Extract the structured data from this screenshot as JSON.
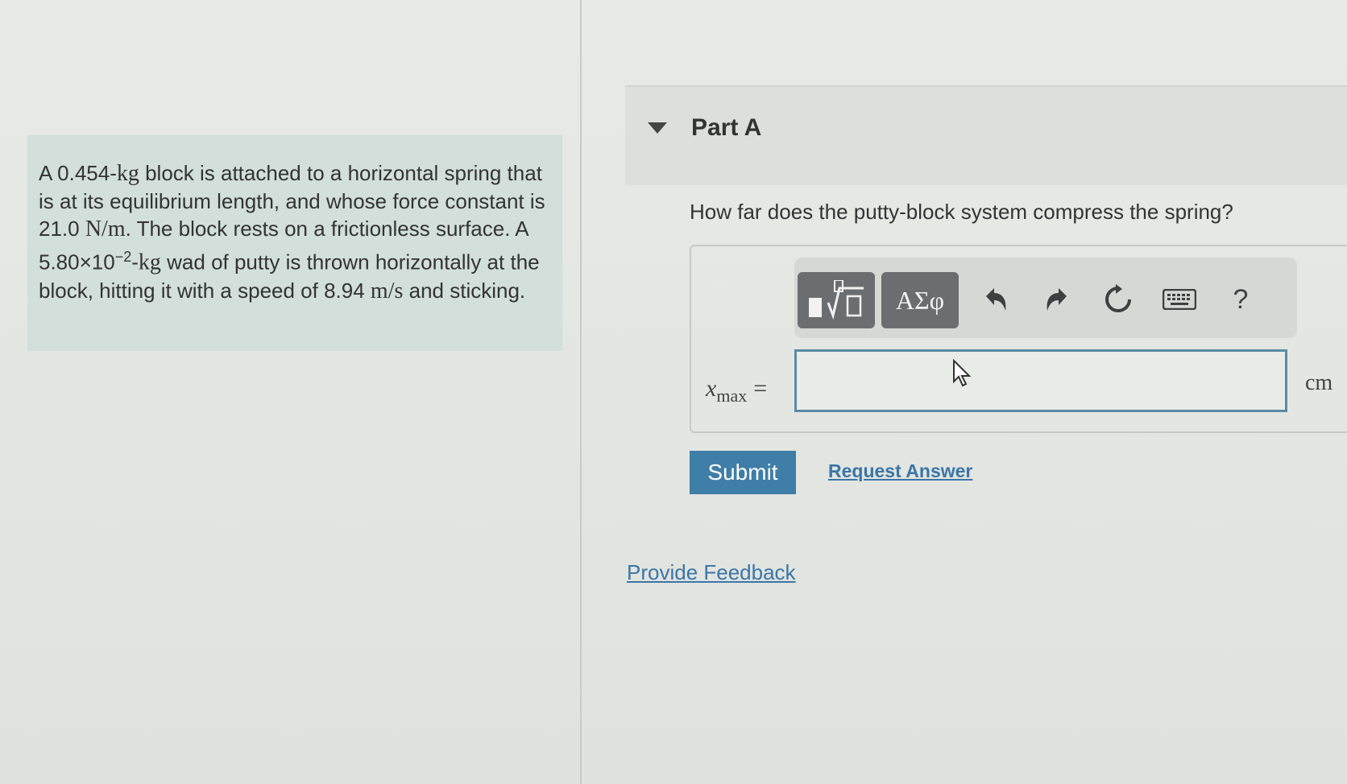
{
  "problem": {
    "seg1": "A 0.454-",
    "unit_kg1": "kg",
    "seg2": " block is attached to a horizontal spring that is at its equilibrium length, and whose force constant is 21.0 ",
    "unit_nm": "N/m",
    "seg3": ". The block rests on a frictionless surface. A 5.80×10",
    "exp": "−2",
    "seg4": "-",
    "unit_kg2": "kg",
    "seg5": " wad of putty is thrown horizontally at the block, hitting it with a speed of 8.94 ",
    "unit_ms": "m/s",
    "seg6": " and sticking."
  },
  "part": {
    "title": "Part A"
  },
  "question": "How far does the putty-block system compress the spring?",
  "toolbar": {
    "greek_label": "ΑΣφ",
    "help_label": "?",
    "icons": [
      "templates-icon",
      "greek-symbols-icon",
      "undo-icon",
      "redo-icon",
      "reset-icon",
      "keyboard-icon",
      "help-icon"
    ]
  },
  "answer": {
    "var": "x",
    "sub": "max",
    "equals": "=",
    "value": "",
    "unit": "cm"
  },
  "actions": {
    "submit_label": "Submit",
    "request_answer_label": "Request Answer",
    "feedback_label": "Provide Feedback"
  },
  "colors": {
    "accent": "#3f7ea6",
    "link": "#3a76a8",
    "problem_bg": "#d2dfdb",
    "input_border": "#5a8ba3"
  }
}
